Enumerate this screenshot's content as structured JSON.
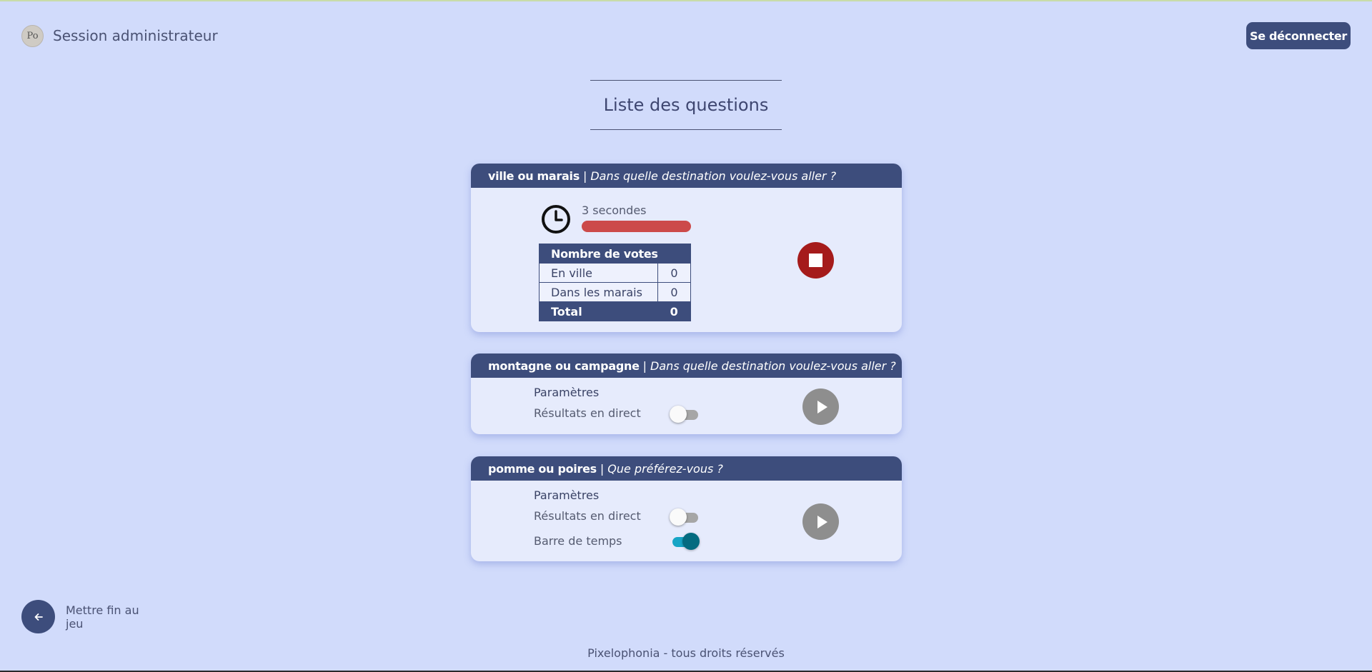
{
  "header": {
    "logo_text": "Po",
    "title": "Session administrateur",
    "logout_label": "Se déconnecter"
  },
  "page": {
    "title": "Liste des questions"
  },
  "questions": [
    {
      "name": "ville ou marais",
      "separator": "|",
      "text": "Dans quelle destination voulez-vous aller ?",
      "timer_label": "3 secondes",
      "timer_progress_percent": 100,
      "votes_header": "Nombre de votes",
      "votes": [
        {
          "label": "En ville",
          "count": "0"
        },
        {
          "label": "Dans les marais",
          "count": "0"
        }
      ],
      "total_label": "Total",
      "total_value": "0"
    },
    {
      "name": "montagne ou campagne",
      "separator": "|",
      "text": "Dans quelle destination voulez-vous aller ?",
      "params_label": "Paramètres",
      "live_results_label": "Résultats en direct",
      "live_results_on": false
    },
    {
      "name": "pomme ou poires",
      "separator": "|",
      "text": "Que préférez-vous ?",
      "params_label": "Paramètres",
      "live_results_label": "Résultats en direct",
      "live_results_on": false,
      "time_bar_label": "Barre de temps",
      "time_bar_on": true
    }
  ],
  "footer": {
    "end_game_label": "Mettre fin au jeu",
    "copyright": "Pixelophonia - tous droits réservés"
  },
  "colors": {
    "background": "#d1dbfb",
    "primary": "#3d4d7c",
    "stop": "#a51b1b",
    "play": "#8e8e8e",
    "toggle_on": "#17a5c6",
    "timer_bar": "#cc4a4a"
  }
}
